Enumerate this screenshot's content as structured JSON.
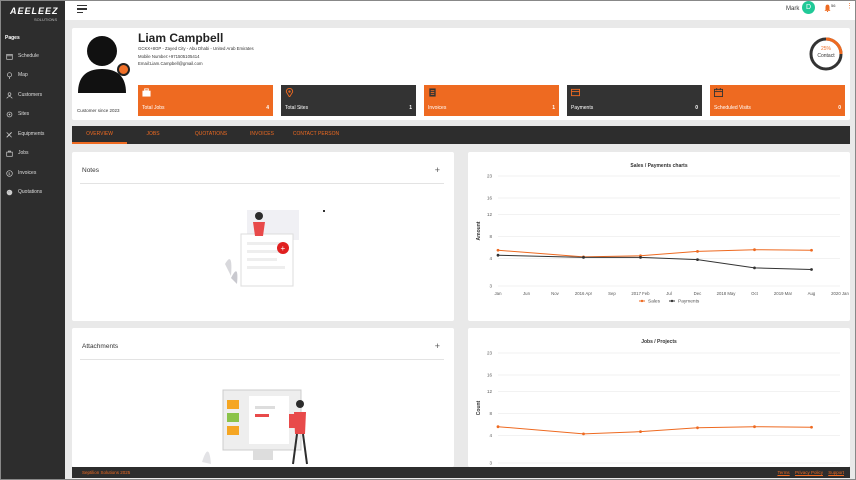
{
  "app": {
    "logo_text": "AEELEEZ",
    "logo_sub": "SOLUTIONS"
  },
  "sidebar": {
    "section_title": "Pages",
    "items": [
      {
        "label": "Schedule",
        "icon": "calendar-icon"
      },
      {
        "label": "Map",
        "icon": "map-pin-icon"
      },
      {
        "label": "Customers",
        "icon": "user-icon"
      },
      {
        "label": "Sites",
        "icon": "gear-icon"
      },
      {
        "label": "Equipments",
        "icon": "tools-icon"
      },
      {
        "label": "Jobs",
        "icon": "briefcase-icon"
      },
      {
        "label": "Invoices",
        "icon": "dollar-icon"
      },
      {
        "label": "Quotations",
        "icon": "quote-icon"
      }
    ]
  },
  "topbar": {
    "user_name": "Mark",
    "avatar_initial": "D",
    "notif_count": "56"
  },
  "profile": {
    "name": "Liam Campbell",
    "address": "GCKX+8GP - Zayed City - Abu Dhabi - United Arab Emirates",
    "mobile": "Mobile Number:+971505105414",
    "email": "Email:Liam.Campbell@gmail.com",
    "since": "Customer since 2023",
    "contact_pct": "25%",
    "contact_label": "Contact",
    "contact_fraction": 0.25
  },
  "stats": [
    {
      "label": "Total Jobs",
      "value": "4",
      "icon": "briefcase-icon",
      "color": "#ee6a21"
    },
    {
      "label": "Total Sites",
      "value": "1",
      "icon": "map-pin-icon",
      "color": "#333333"
    },
    {
      "label": "Invoices",
      "value": "1",
      "icon": "invoice-icon",
      "color": "#ee6a21"
    },
    {
      "label": "Payments",
      "value": "0",
      "icon": "card-icon",
      "color": "#333333"
    },
    {
      "label": "Scheduled Visits",
      "value": "0",
      "icon": "calendar-icon",
      "color": "#ee6a21"
    }
  ],
  "tabs": [
    "OVERVIEW",
    "JOBS",
    "QUOTATIONS",
    "INVOICES",
    "CONTACT PERSON"
  ],
  "notes": {
    "title": "Notes",
    "plus": "+"
  },
  "attachments": {
    "title": "Attachments",
    "plus": "+"
  },
  "footer": {
    "copyright": "Septilion Solutions 2025",
    "links": [
      "Terms",
      "Privacy Policy",
      "Support"
    ]
  },
  "colors": {
    "accent": "#ee6a21",
    "dark": "#2d2d2d",
    "avatar": "#20c997"
  },
  "chart_data": [
    {
      "type": "line",
      "title": "Sales / Payments charts",
      "ylabel": "Amount",
      "ylim": [
        3,
        23
      ],
      "yticks": [
        3,
        8,
        12,
        16,
        19,
        23
      ],
      "ytick_labels": [
        "3",
        "4",
        "8",
        "12",
        "16",
        "23"
      ],
      "xtick_labels": [
        "Jan",
        "Jun",
        "Nov",
        "2016 Apr",
        "Sep",
        "2017 Feb",
        "Jul",
        "Dec",
        "2018 May",
        "Oct",
        "2019 Mar",
        "Aug",
        "2020 Jan"
      ],
      "series": [
        {
          "name": "Sales",
          "color": "#ee6a21",
          "x": [
            0,
            3,
            5,
            7,
            9,
            11
          ],
          "values": [
            9.5,
            8.3,
            8.5,
            9.3,
            9.6,
            9.5
          ]
        },
        {
          "name": "Payments",
          "color": "#333333",
          "x": [
            0,
            3,
            5,
            7,
            9,
            11
          ],
          "values": [
            8.6,
            8.2,
            8.2,
            7.8,
            6.3,
            6.0
          ]
        }
      ],
      "legend": "bottom"
    },
    {
      "type": "line",
      "title": "Jobs / Projects",
      "ylabel": "Count",
      "ylim": [
        3,
        23
      ],
      "yticks": [
        3,
        8,
        12,
        16,
        19,
        23
      ],
      "ytick_labels": [
        "3",
        "4",
        "8",
        "12",
        "16",
        "23"
      ],
      "series": [
        {
          "name": "",
          "color": "#ee6a21",
          "x": [
            0,
            3,
            5,
            7,
            9,
            11
          ],
          "values": [
            9.6,
            8.3,
            8.7,
            9.4,
            9.6,
            9.5
          ]
        }
      ]
    }
  ]
}
